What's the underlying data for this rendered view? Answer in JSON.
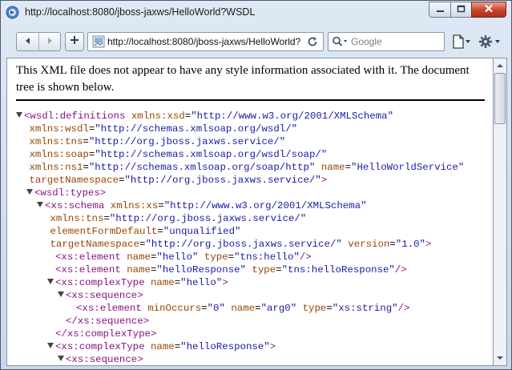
{
  "window": {
    "title": "http://localhost:8080/jboss-jaxws/HelloWorld?WSDL"
  },
  "toolbar": {
    "url": "http://localhost:8080/jboss-jaxws/HelloWorld?",
    "search_placeholder": "Google"
  },
  "page": {
    "info_text": "This XML file does not appear to have any style information associated with it. The document tree is shown below.",
    "xml_lines": [
      {
        "indent": 0,
        "toggle": true,
        "parts": [
          [
            "tag",
            "<wsdl:definitions "
          ],
          [
            "attr",
            "xmlns:xsd"
          ],
          [
            "txt",
            "="
          ],
          [
            "val",
            "\"http://www.w3.org/2001/XMLSchema\""
          ]
        ]
      },
      {
        "indent": 1,
        "toggle": false,
        "parts": [
          [
            "attr",
            "xmlns:wsdl"
          ],
          [
            "txt",
            "="
          ],
          [
            "val",
            "\"http://schemas.xmlsoap.org/wsdl/\""
          ]
        ]
      },
      {
        "indent": 1,
        "toggle": false,
        "parts": [
          [
            "attr",
            "xmlns:tns"
          ],
          [
            "txt",
            "="
          ],
          [
            "val",
            "\"http://org.jboss.jaxws.service/\""
          ]
        ]
      },
      {
        "indent": 1,
        "toggle": false,
        "parts": [
          [
            "attr",
            "xmlns:soap"
          ],
          [
            "txt",
            "="
          ],
          [
            "val",
            "\"http://schemas.xmlsoap.org/wsdl/soap/\""
          ]
        ]
      },
      {
        "indent": 1,
        "toggle": false,
        "parts": [
          [
            "attr",
            "xmlns:ns1"
          ],
          [
            "txt",
            "="
          ],
          [
            "val",
            "\"http://schemas.xmlsoap.org/soap/http\""
          ],
          [
            "txt",
            " "
          ],
          [
            "attr",
            "name"
          ],
          [
            "txt",
            "="
          ],
          [
            "val",
            "\"HelloWorldService\""
          ]
        ]
      },
      {
        "indent": 1,
        "toggle": false,
        "parts": [
          [
            "attr",
            "targetNamespace"
          ],
          [
            "txt",
            "="
          ],
          [
            "val",
            "\"http://org.jboss.jaxws.service/\""
          ],
          [
            "tag",
            ">"
          ]
        ]
      },
      {
        "indent": 2,
        "toggle": true,
        "parts": [
          [
            "tag",
            "<wsdl:types>"
          ]
        ]
      },
      {
        "indent": 4,
        "toggle": true,
        "parts": [
          [
            "tag",
            "<xs:schema "
          ],
          [
            "attr",
            "xmlns:xs"
          ],
          [
            "txt",
            "="
          ],
          [
            "val",
            "\"http://www.w3.org/2001/XMLSchema\""
          ]
        ]
      },
      {
        "indent": 5,
        "toggle": false,
        "parts": [
          [
            "attr",
            "xmlns:tns"
          ],
          [
            "txt",
            "="
          ],
          [
            "val",
            "\"http://org.jboss.jaxws.service/\""
          ]
        ]
      },
      {
        "indent": 5,
        "toggle": false,
        "parts": [
          [
            "attr",
            "elementFormDefault"
          ],
          [
            "txt",
            "="
          ],
          [
            "val",
            "\"unqualified\""
          ]
        ]
      },
      {
        "indent": 5,
        "toggle": false,
        "parts": [
          [
            "attr",
            "targetNamespace"
          ],
          [
            "txt",
            "="
          ],
          [
            "val",
            "\"http://org.jboss.jaxws.service/\""
          ],
          [
            "txt",
            " "
          ],
          [
            "attr",
            "version"
          ],
          [
            "txt",
            "="
          ],
          [
            "val",
            "\"1.0\""
          ],
          [
            "tag",
            ">"
          ]
        ]
      },
      {
        "indent": 6,
        "toggle": false,
        "parts": [
          [
            "tag",
            "<xs:element "
          ],
          [
            "attr",
            "name"
          ],
          [
            "txt",
            "="
          ],
          [
            "val",
            "\"hello\""
          ],
          [
            "txt",
            " "
          ],
          [
            "attr",
            "type"
          ],
          [
            "txt",
            "="
          ],
          [
            "val",
            "\"tns:hello\""
          ],
          [
            "tag",
            "/>"
          ]
        ]
      },
      {
        "indent": 6,
        "toggle": false,
        "parts": [
          [
            "tag",
            "<xs:element "
          ],
          [
            "attr",
            "name"
          ],
          [
            "txt",
            "="
          ],
          [
            "val",
            "\"helloResponse\""
          ],
          [
            "txt",
            " "
          ],
          [
            "attr",
            "type"
          ],
          [
            "txt",
            "="
          ],
          [
            "val",
            "\"tns:helloResponse\""
          ],
          [
            "tag",
            "/>"
          ]
        ]
      },
      {
        "indent": 6,
        "toggle": true,
        "parts": [
          [
            "tag",
            "<xs:complexType "
          ],
          [
            "attr",
            "name"
          ],
          [
            "txt",
            "="
          ],
          [
            "val",
            "\"hello\""
          ],
          [
            "tag",
            ">"
          ]
        ]
      },
      {
        "indent": 8,
        "toggle": true,
        "parts": [
          [
            "tag",
            "<xs:sequence>"
          ]
        ]
      },
      {
        "indent": 10,
        "toggle": false,
        "parts": [
          [
            "tag",
            "<xs:element "
          ],
          [
            "attr",
            "minOccurs"
          ],
          [
            "txt",
            "="
          ],
          [
            "val",
            "\"0\""
          ],
          [
            "txt",
            " "
          ],
          [
            "attr",
            "name"
          ],
          [
            "txt",
            "="
          ],
          [
            "val",
            "\"arg0\""
          ],
          [
            "txt",
            " "
          ],
          [
            "attr",
            "type"
          ],
          [
            "txt",
            "="
          ],
          [
            "val",
            "\"xs:string\""
          ],
          [
            "tag",
            "/>"
          ]
        ]
      },
      {
        "indent": 8,
        "toggle": false,
        "parts": [
          [
            "tag",
            "</xs:sequence>"
          ]
        ]
      },
      {
        "indent": 6,
        "toggle": false,
        "parts": [
          [
            "tag",
            "</xs:complexType>"
          ]
        ]
      },
      {
        "indent": 6,
        "toggle": true,
        "parts": [
          [
            "tag",
            "<xs:complexType "
          ],
          [
            "attr",
            "name"
          ],
          [
            "txt",
            "="
          ],
          [
            "val",
            "\"helloResponse\""
          ],
          [
            "tag",
            ">"
          ]
        ]
      },
      {
        "indent": 8,
        "toggle": true,
        "parts": [
          [
            "tag",
            "<xs:sequence>"
          ]
        ]
      }
    ]
  },
  "colors": {
    "tag": "#881280",
    "attr": "#994500",
    "value": "#1a1aa6",
    "close_button": "#c4432b"
  },
  "icons": [
    "browser-app-icon",
    "minimize-icon",
    "maximize-icon",
    "close-icon",
    "back-arrow-icon",
    "forward-arrow-icon",
    "plus-icon",
    "site-icon",
    "reload-icon",
    "search-engine-icon",
    "page-menu-icon",
    "tools-gear-icon"
  ]
}
